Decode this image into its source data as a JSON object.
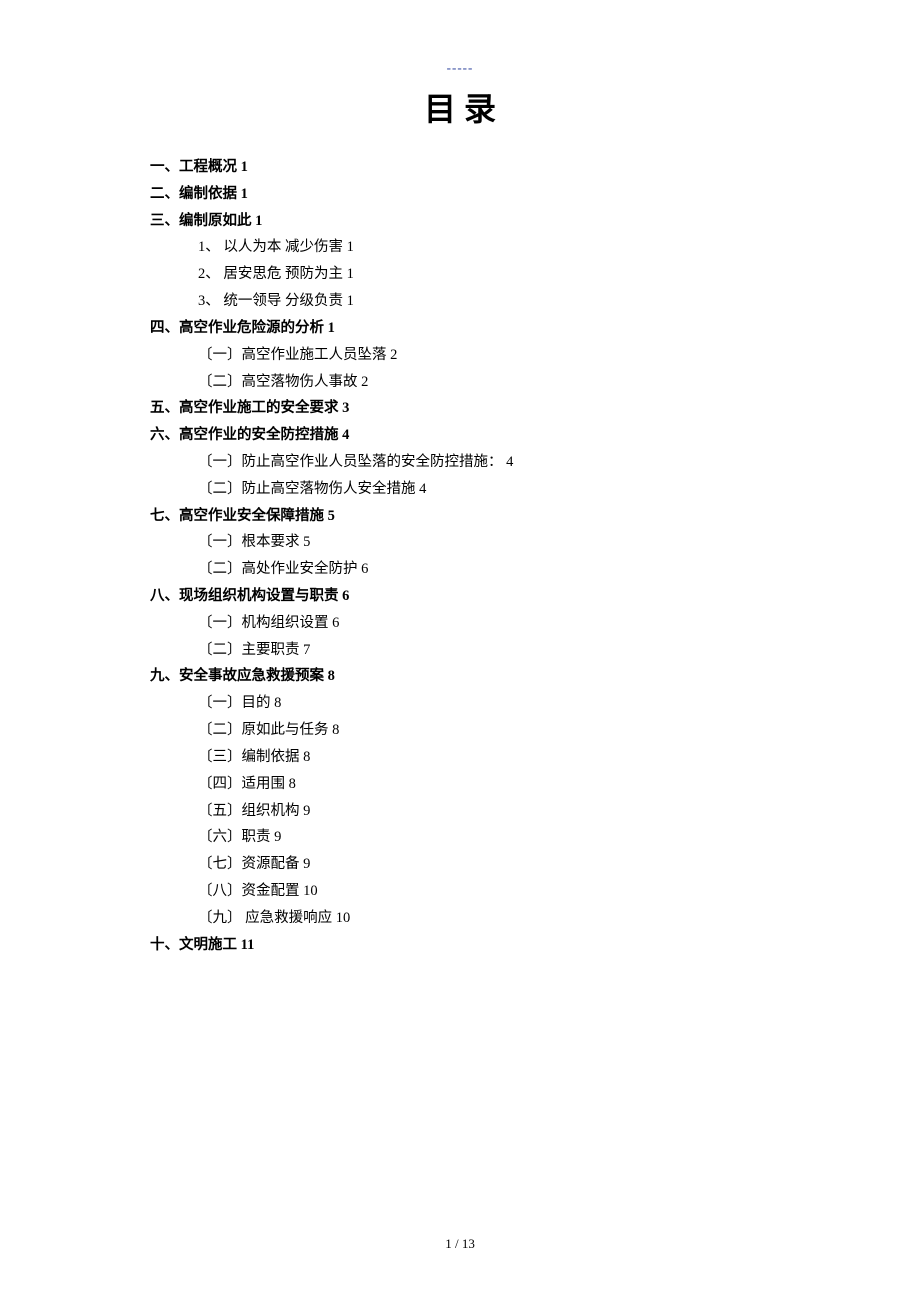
{
  "header_dash": "-----",
  "title": "目 录",
  "toc": [
    {
      "text": "一、工程概况",
      "page": "1",
      "level": 0,
      "bold": true
    },
    {
      "text": "二、编制依据",
      "page": "  1",
      "level": 0,
      "bold": true
    },
    {
      "text": "三、编制原如此",
      "page": "1",
      "level": 0,
      "bold": true
    },
    {
      "text": "1、  以人为本 减少伤害",
      "page": "1",
      "level": 1,
      "bold": false
    },
    {
      "text": "2、  居安思危 预防为主",
      "page": "1",
      "level": 1,
      "bold": false
    },
    {
      "text": "3、  统一领导 分级负责",
      "page": "1",
      "level": 1,
      "bold": false
    },
    {
      "text": "四、高空作业危险源的分析",
      "page": "1",
      "level": 0,
      "bold": true
    },
    {
      "text": "〔一〕高空作业施工人员坠落",
      "page": "2",
      "level": 2,
      "bold": false
    },
    {
      "text": "〔二〕高空落物伤人事故",
      "page": "2",
      "level": 2,
      "bold": false
    },
    {
      "text": "五、高空作业施工的安全要求",
      "page": "3",
      "level": 0,
      "bold": true
    },
    {
      "text": "六、高空作业的安全防控措施",
      "page": "4",
      "level": 0,
      "bold": true
    },
    {
      "text": "〔一〕防止高空作业人员坠落的安全防控措施：",
      "page": "4",
      "level": 2,
      "bold": false
    },
    {
      "text": "〔二〕防止高空落物伤人安全措施",
      "page": "4",
      "level": 2,
      "bold": false
    },
    {
      "text": "七、高空作业安全保障措施",
      "page": "5",
      "level": 0,
      "bold": true
    },
    {
      "text": "〔一〕根本要求",
      "page": "5",
      "level": 2,
      "bold": false
    },
    {
      "text": "〔二〕高处作业安全防护",
      "page": "6",
      "level": 2,
      "bold": false
    },
    {
      "text": "八、现场组织机构设置与职责",
      "page": "6",
      "level": 0,
      "bold": true
    },
    {
      "text": "〔一〕机构组织设置",
      "page": "6",
      "level": 2,
      "bold": false
    },
    {
      "text": "〔二〕主要职责",
      "page": "7",
      "level": 2,
      "bold": false
    },
    {
      "text": "九、安全事故应急救援预案",
      "page": "8",
      "level": 0,
      "bold": true
    },
    {
      "text": "〔一〕目的",
      "page": "8",
      "level": 2,
      "bold": false
    },
    {
      "text": "〔二〕原如此与任务",
      "page": "8",
      "level": 2,
      "bold": false
    },
    {
      "text": "〔三〕编制依据",
      "page": "8",
      "level": 2,
      "bold": false
    },
    {
      "text": "〔四〕适用围",
      "page": "8",
      "level": 2,
      "bold": false
    },
    {
      "text": "〔五〕组织机构",
      "page": "9",
      "level": 2,
      "bold": false
    },
    {
      "text": "〔六〕职责",
      "page": "9",
      "level": 2,
      "bold": false
    },
    {
      "text": "〔七〕资源配备",
      "page": "9",
      "level": 2,
      "bold": false
    },
    {
      "text": "〔八〕资金配置",
      "page": "10",
      "level": 2,
      "bold": false
    },
    {
      "text": "〔九〕 应急救援响应",
      "page": "10",
      "level": 2,
      "bold": false
    },
    {
      "text": "十、文明施工",
      "page": "11",
      "level": 0,
      "bold": true
    }
  ],
  "footer": {
    "current": "1",
    "sep": " / ",
    "total": "13"
  }
}
